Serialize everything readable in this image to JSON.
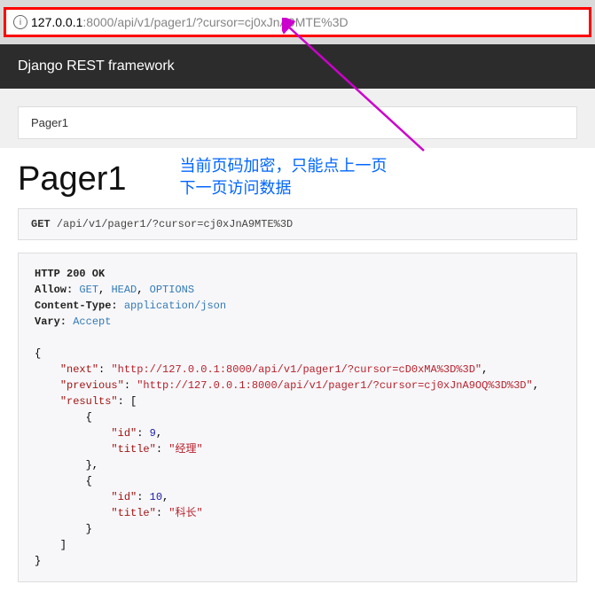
{
  "url": {
    "host": "127.0.0.1",
    "rest": ":8000/api/v1/pager1/?cursor=cj0xJnA9MTE%3D"
  },
  "header": {
    "brand": "Django REST framework"
  },
  "breadcrumb": {
    "label": "Pager1"
  },
  "page": {
    "title": "Pager1"
  },
  "annotation": {
    "text": "当前页码加密，只能点上一页\n下一页访问数据"
  },
  "request": {
    "method": "GET",
    "path": "/api/v1/pager1/?cursor=cj0xJnA9MTE%3D"
  },
  "response": {
    "status_line": "HTTP 200 OK",
    "allow_label": "Allow:",
    "allow_values": [
      "GET",
      "HEAD",
      "OPTIONS"
    ],
    "content_type_label": "Content-Type:",
    "content_type_value": "application/json",
    "vary_label": "Vary:",
    "vary_value": "Accept",
    "body": {
      "next_key": "\"next\"",
      "next_val": "\"http://127.0.0.1:8000/api/v1/pager1/?cursor=cD0xMA%3D%3D\"",
      "prev_key": "\"previous\"",
      "prev_val": "\"http://127.0.0.1:8000/api/v1/pager1/?cursor=cj0xJnA9OQ%3D%3D\"",
      "results_key": "\"results\"",
      "item1_id_key": "\"id\"",
      "item1_id_val": "9",
      "item1_title_key": "\"title\"",
      "item1_title_val": "\"经理\"",
      "item2_id_key": "\"id\"",
      "item2_id_val": "10",
      "item2_title_key": "\"title\"",
      "item2_title_val": "\"科长\""
    }
  }
}
